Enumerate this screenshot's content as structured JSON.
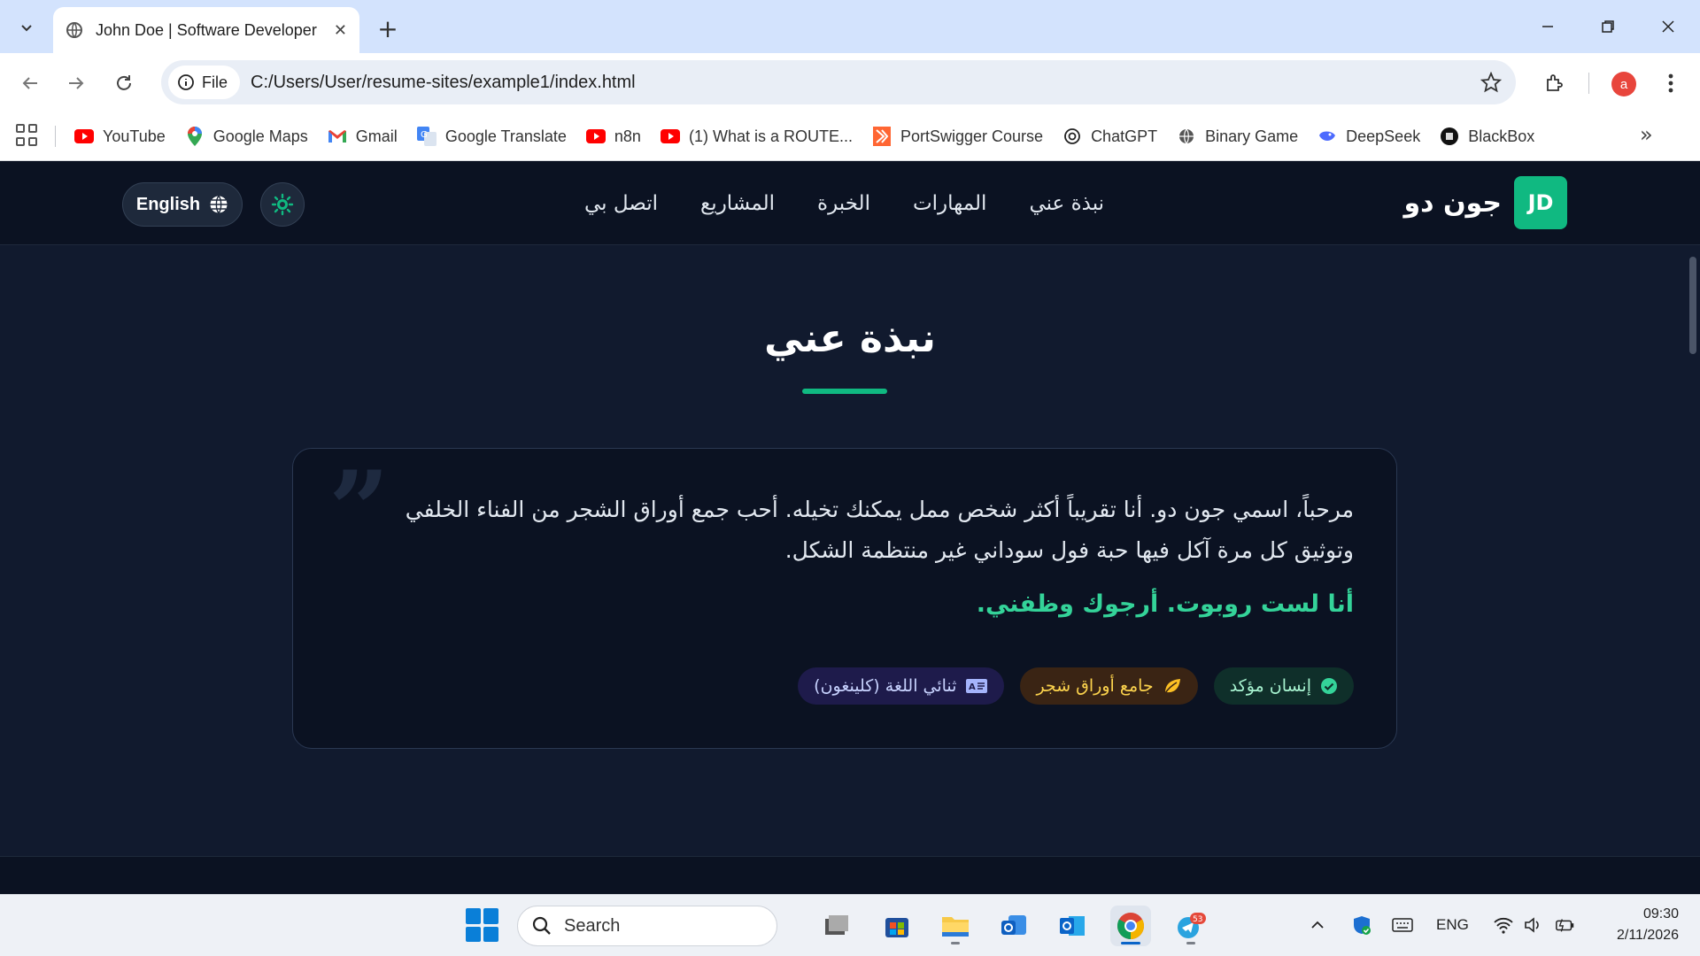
{
  "browser": {
    "tab_title": "John Doe | Software Developer",
    "tab_close": "✕",
    "new_tab": "+",
    "file_chip": "File",
    "url": "C:/Users/User/resume-sites/example1/index.html",
    "profile_initial": "a",
    "bookmarks_more": "»",
    "bookmarks": [
      {
        "label": "YouTube",
        "icon": "youtube-icon"
      },
      {
        "label": "Google Maps",
        "icon": "maps-icon"
      },
      {
        "label": "Gmail",
        "icon": "gmail-icon"
      },
      {
        "label": "Google Translate",
        "icon": "translate-icon"
      },
      {
        "label": "n8n",
        "icon": "youtube-icon"
      },
      {
        "label": "(1) What is a ROUTE...",
        "icon": "youtube-icon"
      },
      {
        "label": "PortSwigger Course",
        "icon": "portswigger-icon"
      },
      {
        "label": "ChatGPT",
        "icon": "chatgpt-icon"
      },
      {
        "label": "Binary Game",
        "icon": "globe-icon"
      },
      {
        "label": "DeepSeek",
        "icon": "deepseek-icon"
      },
      {
        "label": "BlackBox",
        "icon": "blackbox-icon"
      }
    ]
  },
  "site": {
    "logo_text": "JD",
    "brand_name": "جون دو",
    "nav": [
      "نبذة عني",
      "المهارات",
      "الخبرة",
      "المشاريع",
      "اتصل بي"
    ],
    "lang_button": "English",
    "about": {
      "title": "نبذة عني",
      "quote_mark": "”",
      "paragraph": "مرحباً، اسمي جون دو. أنا تقريباً أكثر شخص ممل يمكنك تخيله. أحب جمع أوراق الشجر من الفناء الخلفي وتوثيق كل مرة آكل فيها حبة فول سوداني غير منتظمة الشكل.",
      "highlight": "أنا لست روبوت. أرجوك وظفني.",
      "badges": [
        {
          "label": "إنسان مؤكد",
          "icon": "check-circle-icon",
          "color": "#34d399"
        },
        {
          "label": "جامع أوراق شجر",
          "icon": "leaf-icon",
          "color": "#fbbf24"
        },
        {
          "label": "ثنائي اللغة (كلينغون)",
          "icon": "language-icon",
          "color": "#a5b4fc"
        }
      ]
    },
    "accent_color": "#10b981"
  },
  "taskbar": {
    "search_placeholder": "Search",
    "language": "ENG",
    "time": "09:30",
    "date": "2/11/2026",
    "telegram_badge": "53"
  }
}
